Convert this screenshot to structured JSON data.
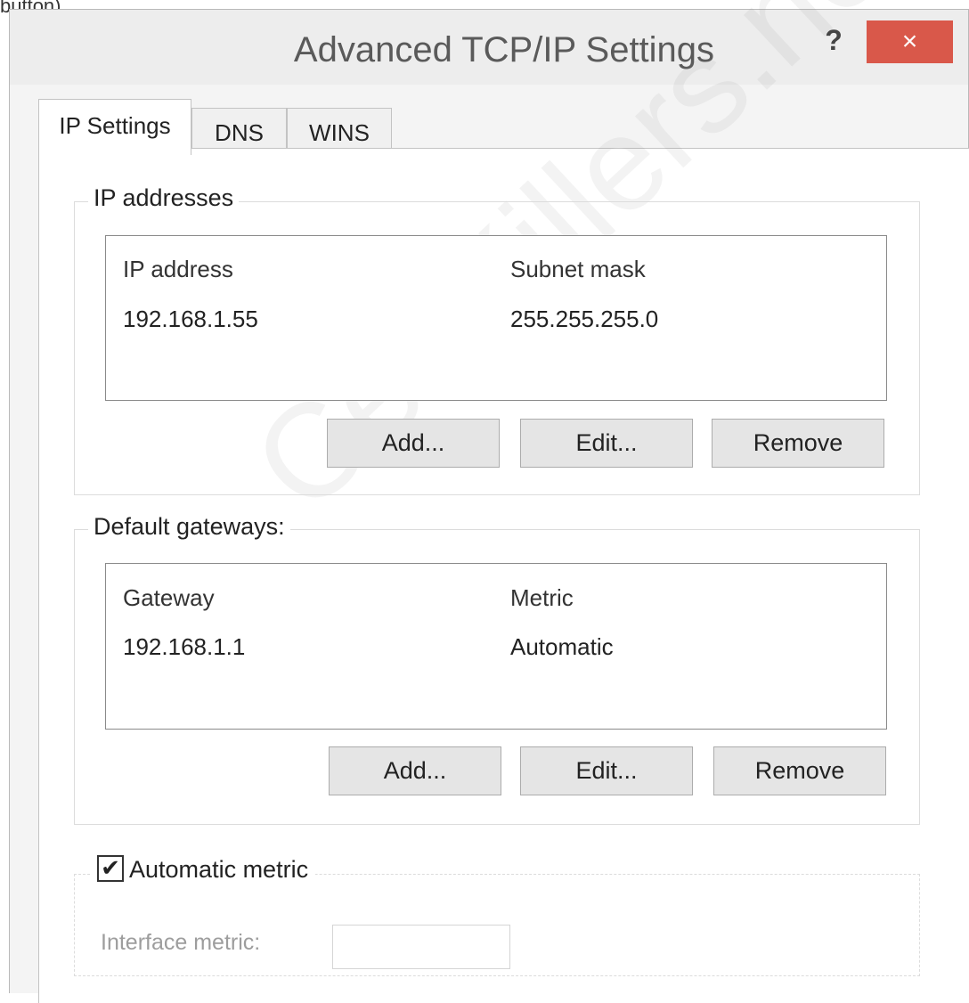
{
  "caption": "button)",
  "window": {
    "title": "Advanced TCP/IP Settings",
    "help_label": "?",
    "close_label": "×"
  },
  "tabs": [
    {
      "label": "IP Settings",
      "active": true
    },
    {
      "label": "DNS",
      "active": false
    },
    {
      "label": "WINS",
      "active": false
    }
  ],
  "ip_addresses": {
    "group_label": "IP addresses",
    "columns": [
      "IP address",
      "Subnet mask"
    ],
    "rows": [
      [
        "192.168.1.55",
        "255.255.255.0"
      ]
    ],
    "buttons": {
      "add": "Add...",
      "edit": "Edit...",
      "remove": "Remove"
    }
  },
  "gateways": {
    "group_label": "Default gateways:",
    "columns": [
      "Gateway",
      "Metric"
    ],
    "rows": [
      [
        "192.168.1.1",
        "Automatic"
      ]
    ],
    "buttons": {
      "add": "Add...",
      "edit": "Edit...",
      "remove": "Remove"
    }
  },
  "metric": {
    "automatic_label": "Automatic metric",
    "automatic_checked": true,
    "check_glyph": "✔",
    "interface_label": "Interface metric:",
    "interface_value": ""
  },
  "watermark": "CertKillers.net"
}
